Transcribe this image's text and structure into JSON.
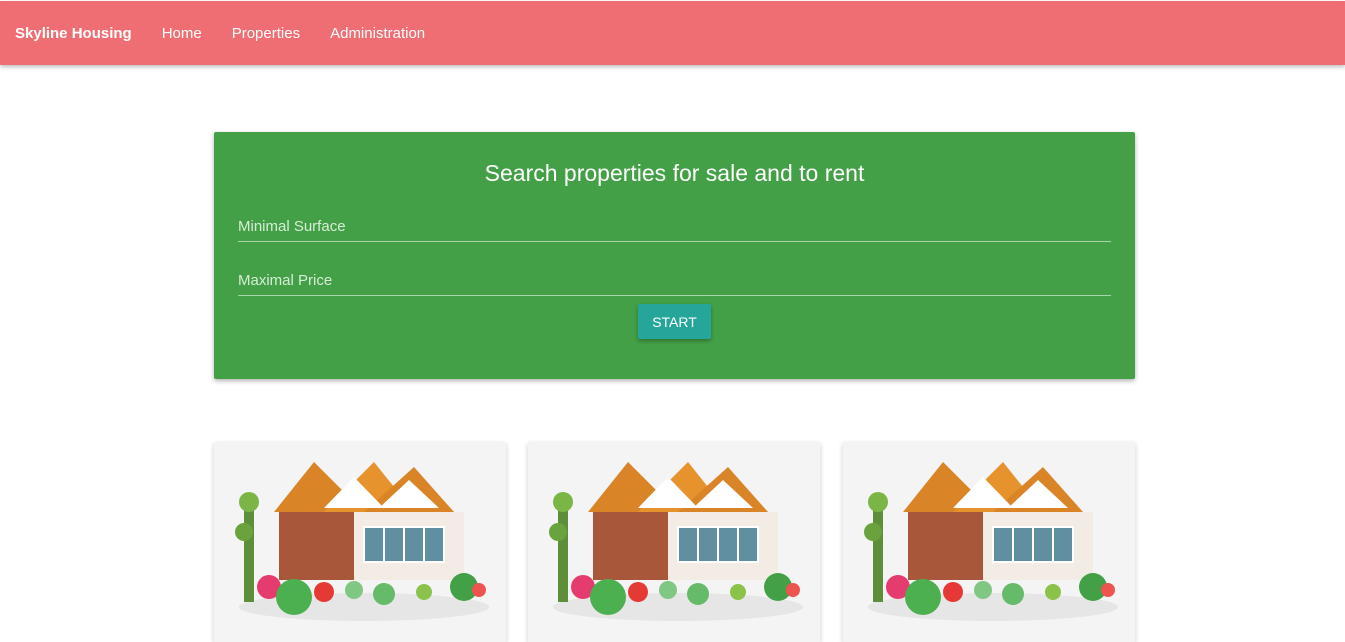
{
  "navbar": {
    "brand": "Skyline Housing",
    "links": [
      "Home",
      "Properties",
      "Administration"
    ],
    "background": "#ef6e73"
  },
  "search": {
    "title": "Search properties for sale and to rent",
    "min_surface_placeholder": "Minimal Surface",
    "max_price_placeholder": "Maximal Price",
    "start_label": "START",
    "background": "#43a047",
    "button_color": "#26a69a"
  },
  "properties": [
    {
      "image": "house-image"
    },
    {
      "image": "house-image"
    },
    {
      "image": "house-image"
    }
  ]
}
